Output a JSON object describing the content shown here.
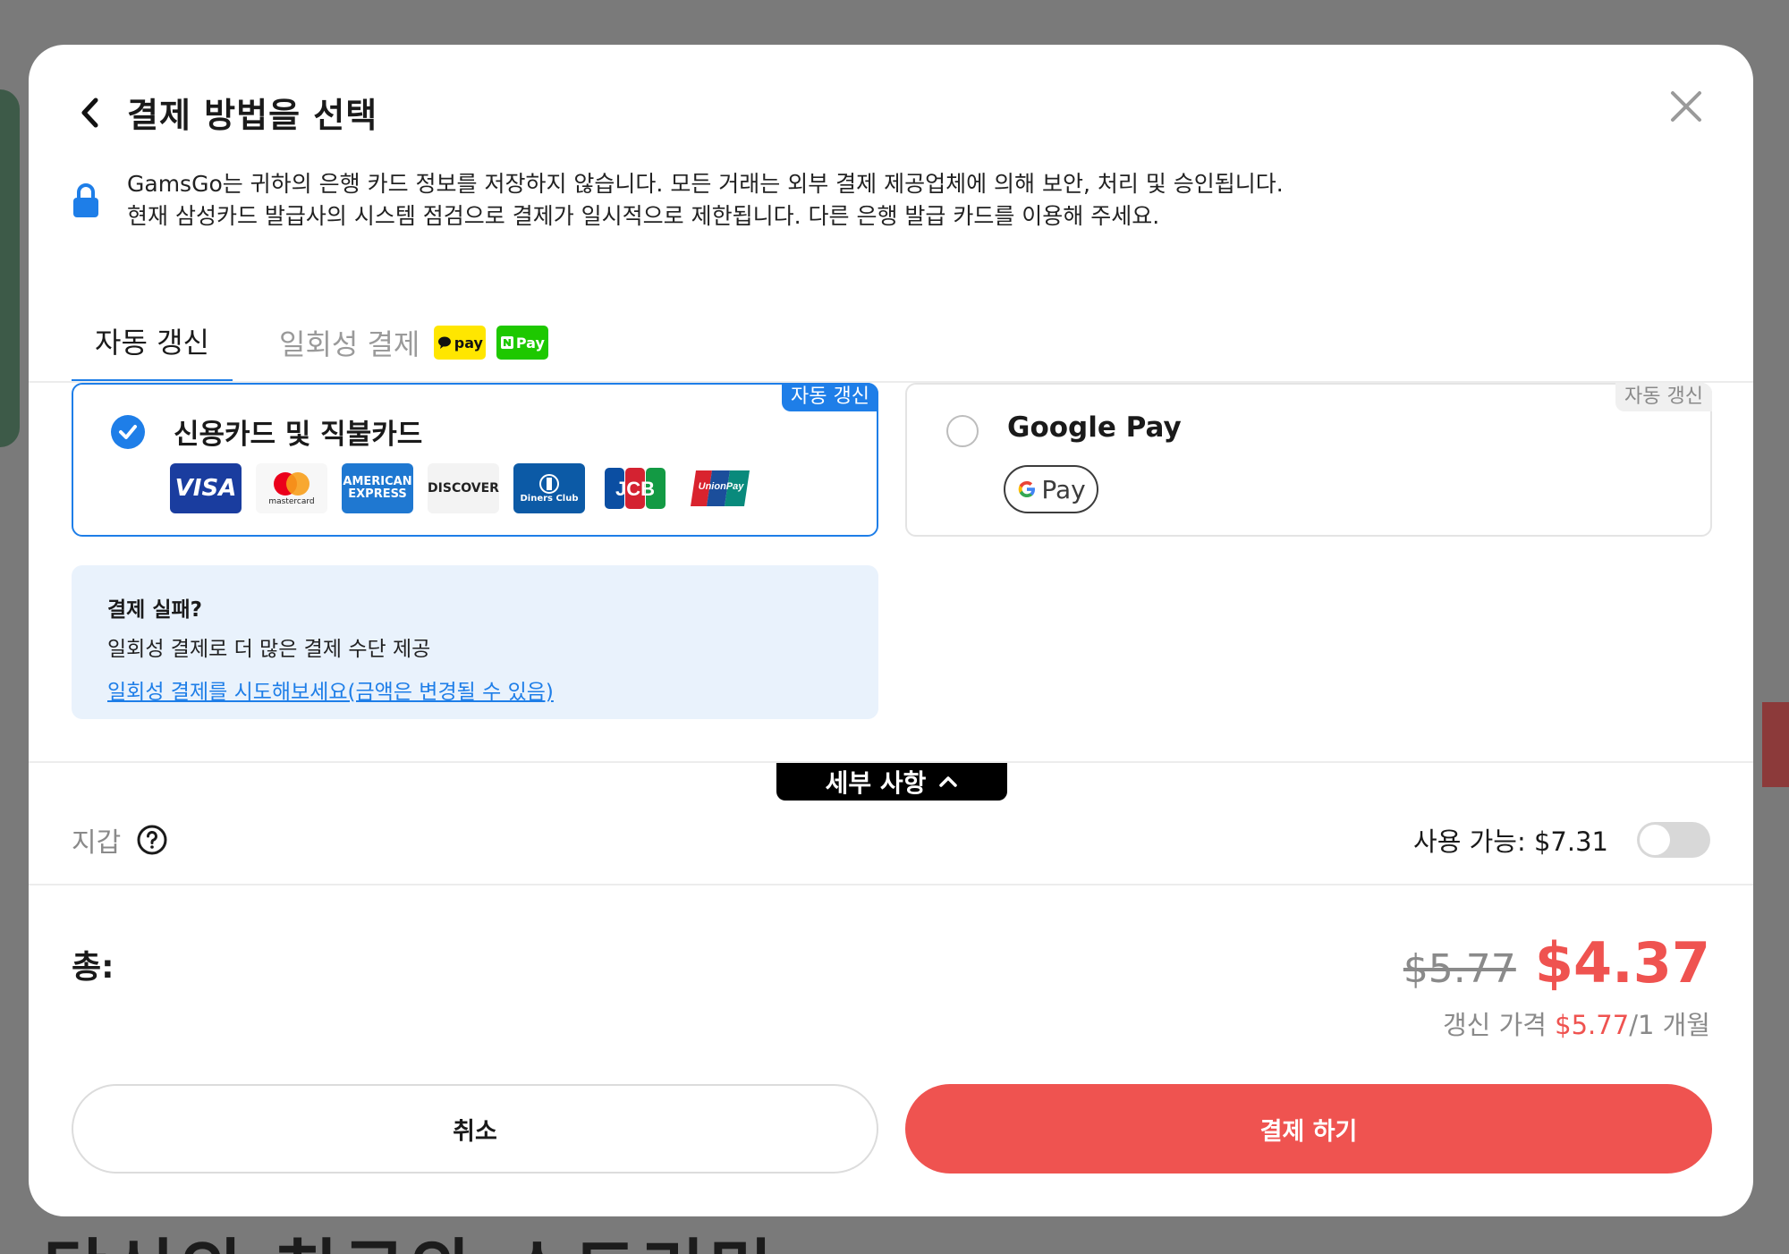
{
  "backdrop": {
    "bottom_text": "당신의 친구와 스트리밍"
  },
  "header": {
    "title": "결제 방법을 선택"
  },
  "notice": {
    "line1": "GamsGo는 귀하의 은행 카드 정보를 저장하지 않습니다. 모든 거래는 외부 결제 제공업체에 의해 보안, 처리 및 승인됩니다.",
    "line2": "현재 삼성카드 발급사의 시스템 점검으로 결제가 일시적으로 제한됩니다. 다른 은행 발급 카드를 이용해 주세요."
  },
  "tabs": [
    {
      "label": "자동 갱신",
      "active": true
    },
    {
      "label": "일회성 결제",
      "active": false,
      "badges": [
        "pay",
        "Pay"
      ]
    }
  ],
  "methods": {
    "credit": {
      "label": "신용카드 및 직불카드",
      "badge": "자동 갱신",
      "selected": true,
      "brands": [
        "VISA",
        "mastercard",
        "AMERICAN EXPRESS",
        "DISCOVER",
        "Diners Club",
        "JCB",
        "UnionPay"
      ]
    },
    "gpay": {
      "label": "Google Pay",
      "badge": "자동 갱신",
      "selected": false,
      "chip": "Pay"
    }
  },
  "fail_box": {
    "title": "결제 실패?",
    "desc": "일회성 결제로 더 많은 결제 수단 제공",
    "link": "일회성 결제를 시도해보세요(금액은 변경될 수 있음)"
  },
  "details": {
    "label": "세부 사항"
  },
  "wallet": {
    "label": "지갑",
    "available": "사용 가능: $7.31",
    "enabled": false
  },
  "total": {
    "label": "총:",
    "old_price": "$5.77",
    "new_price": "$4.37",
    "renew_prefix": "갱신 가격",
    "renew_price": "$5.77",
    "renew_period": "/1 개월"
  },
  "buttons": {
    "cancel": "취소",
    "pay": "결제 하기"
  },
  "colors": {
    "accent": "#1e7ee8",
    "price_red": "#ef5350"
  }
}
